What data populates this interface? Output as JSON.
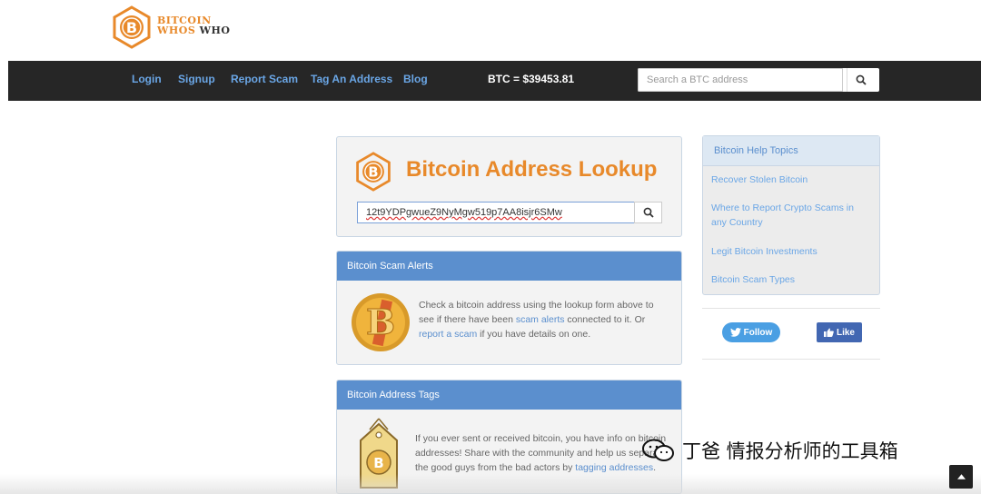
{
  "brand": {
    "line1": "BITCOIN",
    "line2a": "WHOS",
    "line2b": "WHO"
  },
  "nav": {
    "items": [
      "Login",
      "Signup",
      "Report Scam",
      "Tag An Address",
      "Blog"
    ],
    "btc_price": "BTC = $39453.81",
    "search_placeholder": "Search a BTC address"
  },
  "lookup": {
    "title": "Bitcoin Address Lookup",
    "address_value": "12t9YDPgwueZ9NyMgw519p7AA8isjr6SMw"
  },
  "alerts": {
    "header": "Bitcoin Scam Alerts",
    "text1": "Check a bitcoin address using the lookup form above to see if there have been ",
    "link1": "scam alerts",
    "text2": " connected to it. Or ",
    "link2": "report a scam",
    "text3": " if you have details on one."
  },
  "tags": {
    "header": "Bitcoin Address Tags",
    "text1": "If you ever sent or received bitcoin, you have info on bitcoin addresses! Share with the community and help us separate the good guys from the bad actors by ",
    "link1": "tagging addresses",
    "text2": "."
  },
  "help": {
    "header": "Bitcoin Help Topics",
    "items": [
      "Recover Stolen Bitcoin",
      "Where to Report Crypto Scams in any Country",
      "Legit Bitcoin Investments",
      "Bitcoin Scam Types"
    ]
  },
  "social": {
    "follow": "Follow",
    "like": "Like"
  },
  "watermark": "丁爸 情报分析师的工具箱",
  "colors": {
    "orange": "#e8892a",
    "navbar": "#262626",
    "link": "#6aa6e6",
    "panel_header": "#5b8fce"
  },
  "icons": [
    "bitcoin-logo-icon",
    "search-icon",
    "bitcoin-coin-icon",
    "price-tag-icon",
    "twitter-bird-icon",
    "thumbs-up-icon",
    "wechat-icon",
    "chevron-up-icon"
  ]
}
